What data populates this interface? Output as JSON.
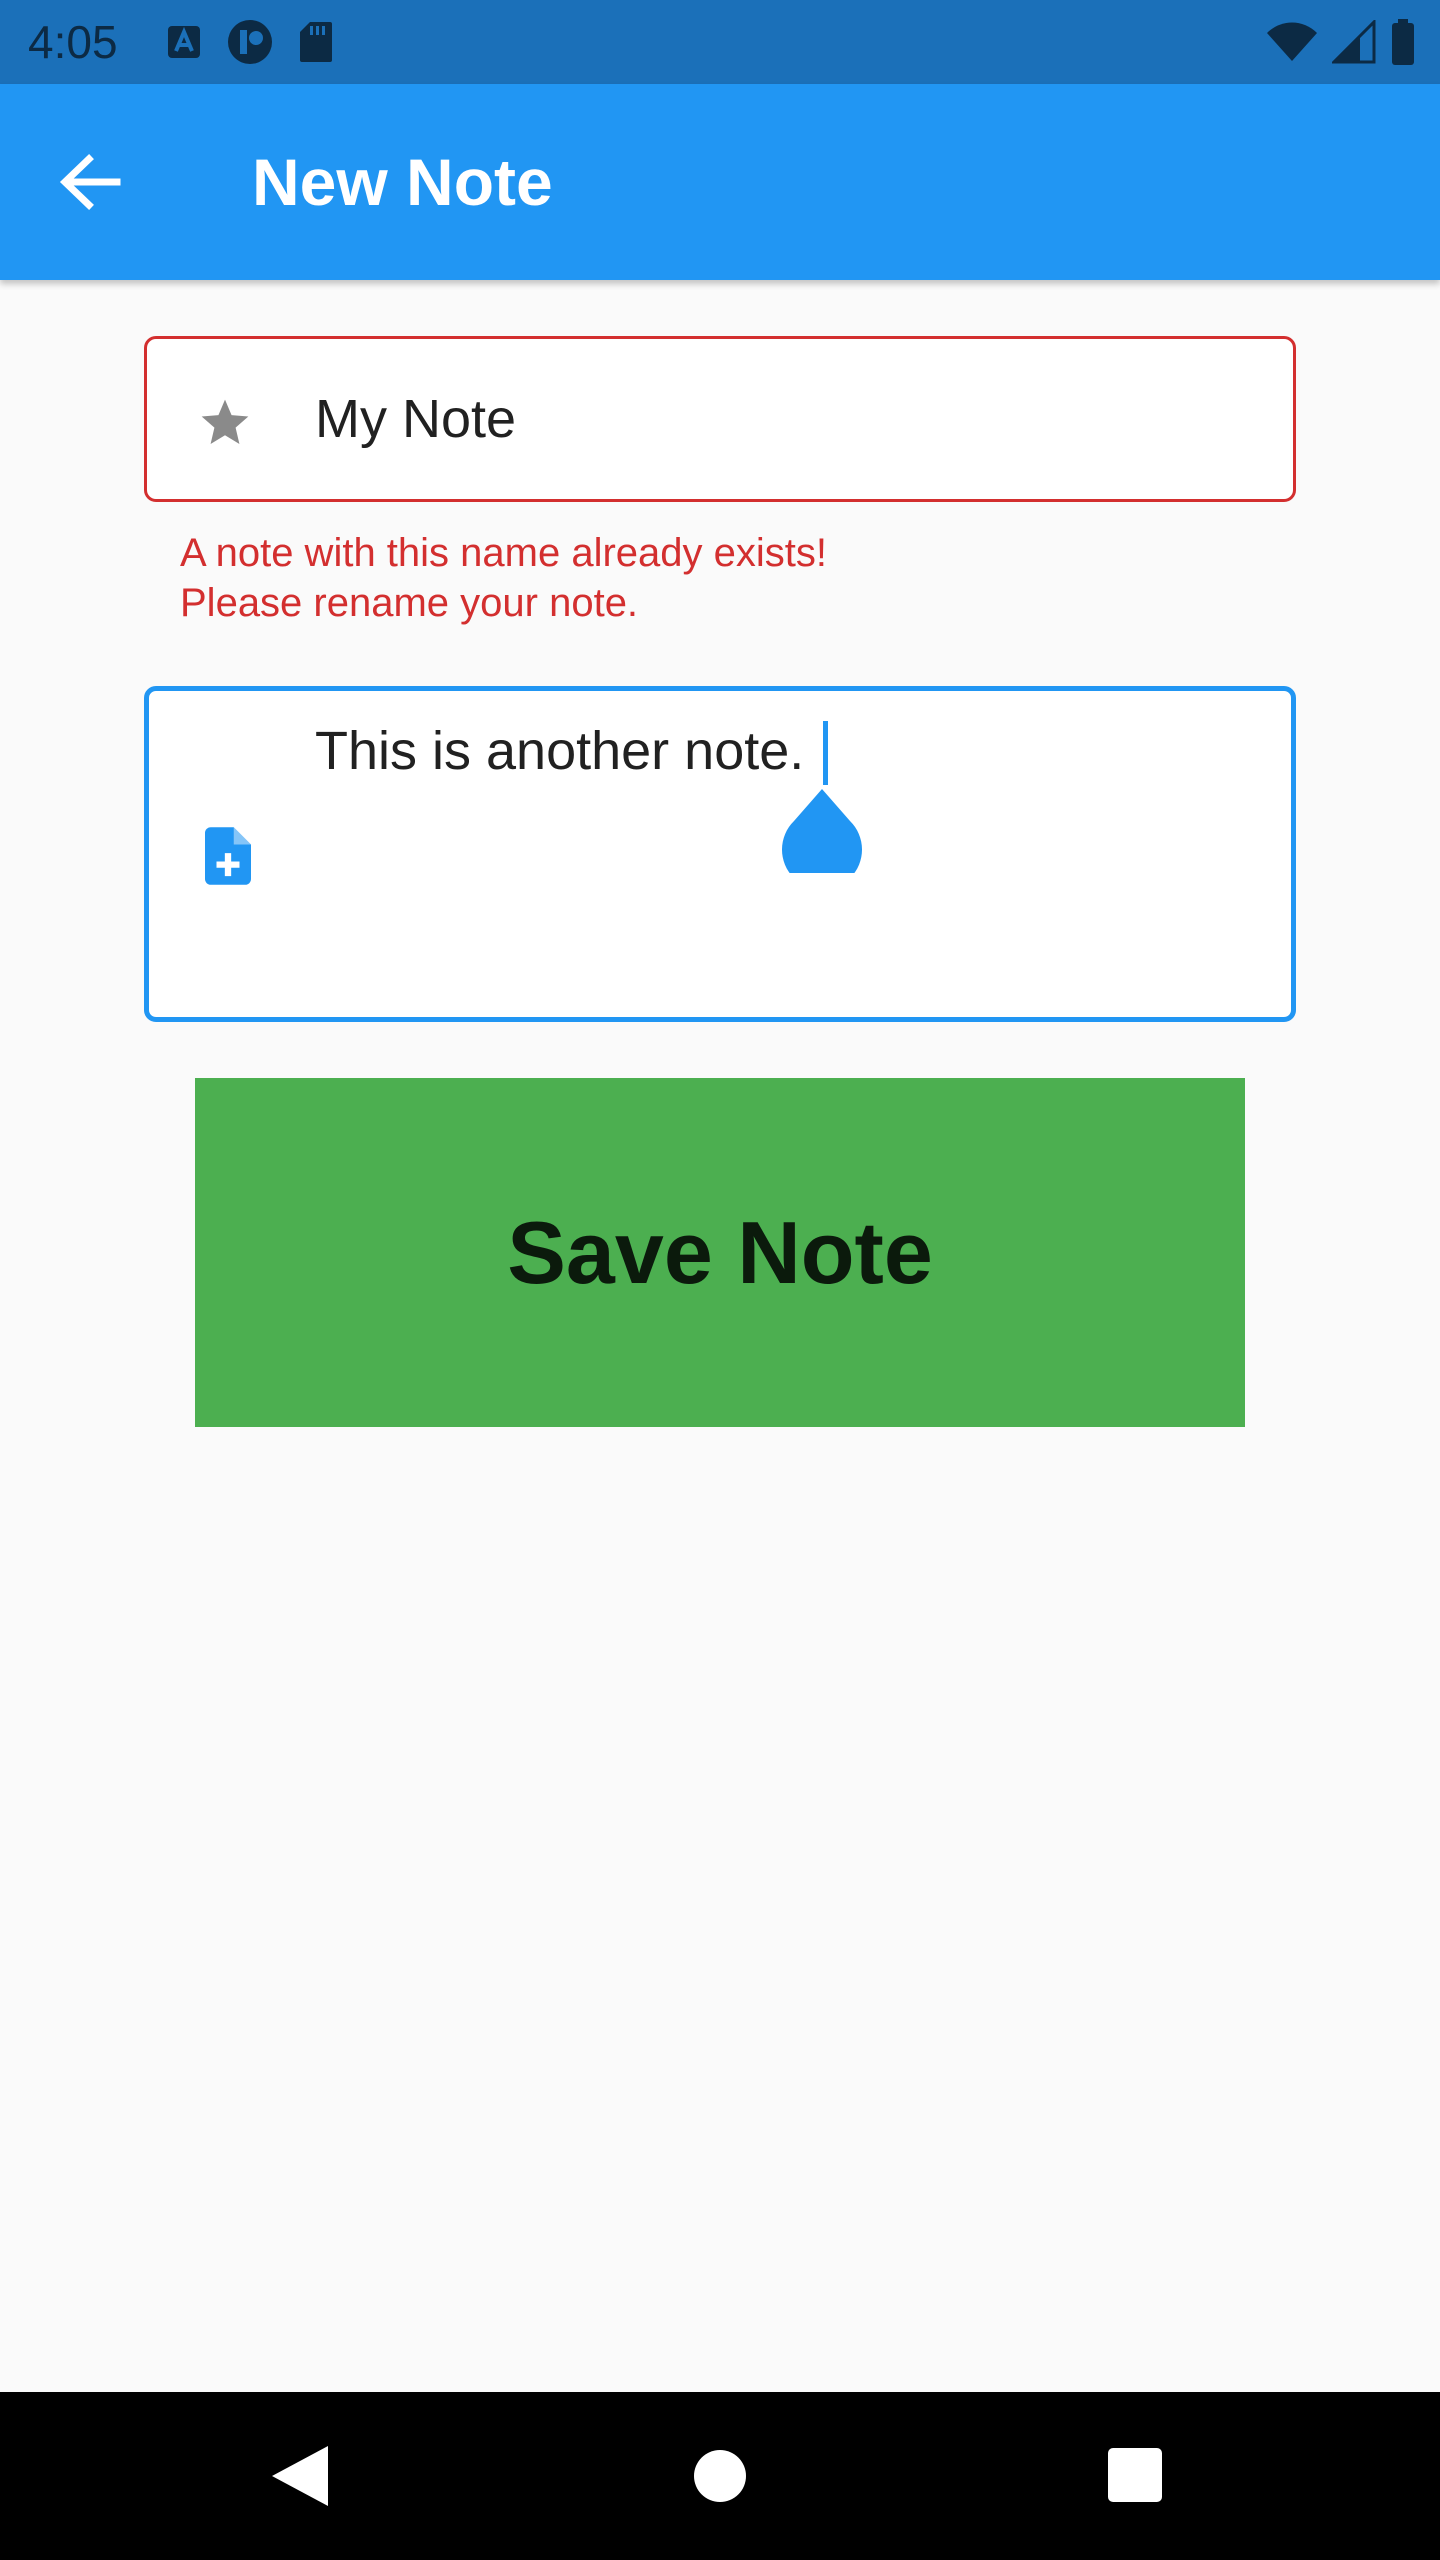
{
  "status_bar": {
    "time": "4:05",
    "left_icons": [
      "a-notification-icon",
      "r-notification-icon",
      "sd-card-icon"
    ],
    "right_icons": [
      "wifi-icon",
      "cellular-signal-icon",
      "battery-icon"
    ]
  },
  "app_bar": {
    "title": "New Note",
    "back_icon": "arrow-back-icon"
  },
  "form": {
    "title_field": {
      "value": "My Note",
      "icon": "star-icon",
      "error_line1": "A note with this name already exists!",
      "error_line2": "Please rename your note."
    },
    "content_field": {
      "value": "This is another note.",
      "icon": "note-add-icon"
    },
    "save_label": "Save Note"
  },
  "nav_bar": {
    "icons": [
      "nav-back-icon",
      "nav-home-icon",
      "nav-recents-icon"
    ]
  },
  "colors": {
    "status_bar": "#1b70b9",
    "app_bar": "#2196f3",
    "error": "#d32f2f",
    "focus": "#2196f3",
    "save_button": "#4caf50",
    "background": "#fafafa"
  }
}
